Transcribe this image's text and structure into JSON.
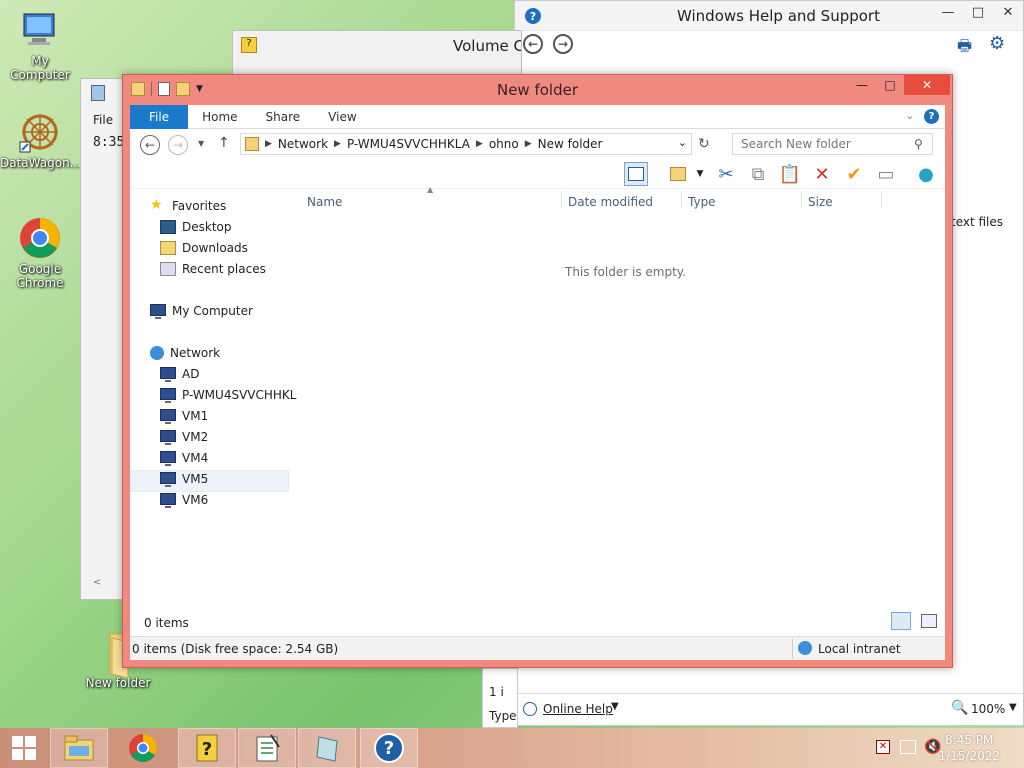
{
  "desktop": {
    "icons": [
      {
        "label": "My Computer"
      },
      {
        "label": "DataWagon..."
      },
      {
        "label": "Google Chrome"
      },
      {
        "label": "New folder"
      }
    ]
  },
  "help_window": {
    "title": "Windows Help and Support",
    "online_help": "Online Help",
    "zoom": "100%",
    "side_text": "text files"
  },
  "volume_window": {
    "title": "Volume C"
  },
  "notepad_window": {
    "menu": "File",
    "time": "8:35"
  },
  "partial_window": {
    "count": "1 i",
    "type": "Type"
  },
  "explorer": {
    "title": "New folder",
    "tabs": {
      "file": "File",
      "home": "Home",
      "share": "Share",
      "view": "View"
    },
    "address": [
      "Network",
      "P-WMU4SVVCHHKLA",
      "ohno",
      "New folder"
    ],
    "search_placeholder": "Search New folder",
    "columns": {
      "name": "Name",
      "date": "Date modified",
      "type": "Type",
      "size": "Size"
    },
    "empty_message": "This folder is empty.",
    "nav": {
      "favorites": "Favorites",
      "desktop": "Desktop",
      "downloads": "Downloads",
      "recent": "Recent places",
      "my_computer": "My Computer",
      "network": "Network",
      "hosts": [
        "AD",
        "P-WMU4SVVCHHKL",
        "VM1",
        "VM2",
        "VM4",
        "VM5",
        "VM6"
      ]
    },
    "items_count": "0 items",
    "status_detail": "0 items (Disk free space: 2.54 GB)",
    "zone": "Local intranet"
  },
  "taskbar": {
    "time": "8:45 PM",
    "date": "1/15/2022"
  }
}
